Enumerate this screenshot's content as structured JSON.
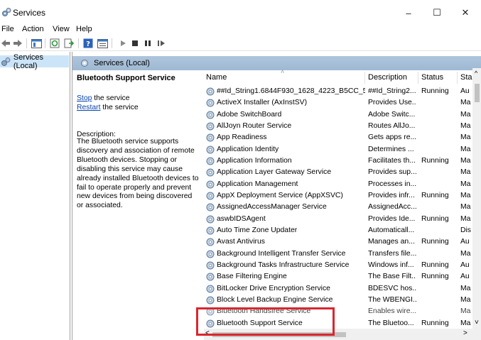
{
  "window": {
    "title": "Services",
    "minimize": "–",
    "maximize": "☐",
    "close": "✕"
  },
  "menu": [
    "File",
    "Action",
    "View",
    "Help"
  ],
  "tree": {
    "root": "Services (Local)"
  },
  "panel": {
    "header": "Services (Local)",
    "service_title": "Bluetooth Support Service",
    "stop_link": "Stop",
    "stop_suffix": " the service",
    "restart_link": "Restart",
    "restart_suffix": " the service",
    "description_label": "Description:",
    "description_lines": [
      "The Bluetooth service supports",
      "discovery and association of remote",
      "Bluetooth devices.  Stopping or",
      "disabling this service may cause",
      "already installed Bluetooth devices to",
      "fail to operate properly and prevent",
      "new devices from being discovered",
      "or associated."
    ]
  },
  "columns": {
    "name": "Name",
    "description": "Description",
    "status": "Status",
    "startup": "Sta"
  },
  "services": [
    {
      "name": "##Id_String1.6844F930_1628_4223_B5CC_5BB...",
      "desc": "##Id_String2...",
      "status": "Running",
      "start": "Au"
    },
    {
      "name": "ActiveX Installer (AxInstSV)",
      "desc": "Provides Use...",
      "status": "",
      "start": "Ma"
    },
    {
      "name": "Adobe SwitchBoard",
      "desc": "Adobe Switc...",
      "status": "",
      "start": "Ma"
    },
    {
      "name": "AllJoyn Router Service",
      "desc": "Routes AllJo...",
      "status": "",
      "start": "Ma"
    },
    {
      "name": "App Readiness",
      "desc": "Gets apps re...",
      "status": "",
      "start": "Ma"
    },
    {
      "name": "Application Identity",
      "desc": "Determines ...",
      "status": "",
      "start": "Ma"
    },
    {
      "name": "Application Information",
      "desc": "Facilitates th...",
      "status": "Running",
      "start": "Ma"
    },
    {
      "name": "Application Layer Gateway Service",
      "desc": "Provides sup...",
      "status": "",
      "start": "Ma"
    },
    {
      "name": "Application Management",
      "desc": "Processes in...",
      "status": "",
      "start": "Ma"
    },
    {
      "name": "AppX Deployment Service (AppXSVC)",
      "desc": "Provides infr...",
      "status": "Running",
      "start": "Ma"
    },
    {
      "name": "AssignedAccessManager Service",
      "desc": "AssignedAcc...",
      "status": "",
      "start": "Ma"
    },
    {
      "name": "aswbIDSAgent",
      "desc": "Provides Ide...",
      "status": "Running",
      "start": "Ma"
    },
    {
      "name": "Auto Time Zone Updater",
      "desc": "Automaticall...",
      "status": "",
      "start": "Dis"
    },
    {
      "name": "Avast Antivirus",
      "desc": "Manages an...",
      "status": "Running",
      "start": "Au"
    },
    {
      "name": "Background Intelligent Transfer Service",
      "desc": "Transfers file...",
      "status": "",
      "start": "Ma"
    },
    {
      "name": "Background Tasks Infrastructure Service",
      "desc": "Windows inf...",
      "status": "Running",
      "start": "Au"
    },
    {
      "name": "Base Filtering Engine",
      "desc": "The Base Filt...",
      "status": "Running",
      "start": "Au"
    },
    {
      "name": "BitLocker Drive Encryption Service",
      "desc": "BDESVC hos...",
      "status": "",
      "start": "Ma"
    },
    {
      "name": "Block Level Backup Engine Service",
      "desc": "The WBENGI...",
      "status": "",
      "start": "Ma"
    },
    {
      "name": "Bluetooth Handsfree Service",
      "desc": "Enables wire...",
      "status": "",
      "start": "Ma"
    },
    {
      "name": "Bluetooth Support Service",
      "desc": "The Bluetoo...",
      "status": "Running",
      "start": "Ma"
    }
  ],
  "scroll": {
    "up": "^",
    "down": "˅",
    "left": "<",
    "right": ">"
  }
}
